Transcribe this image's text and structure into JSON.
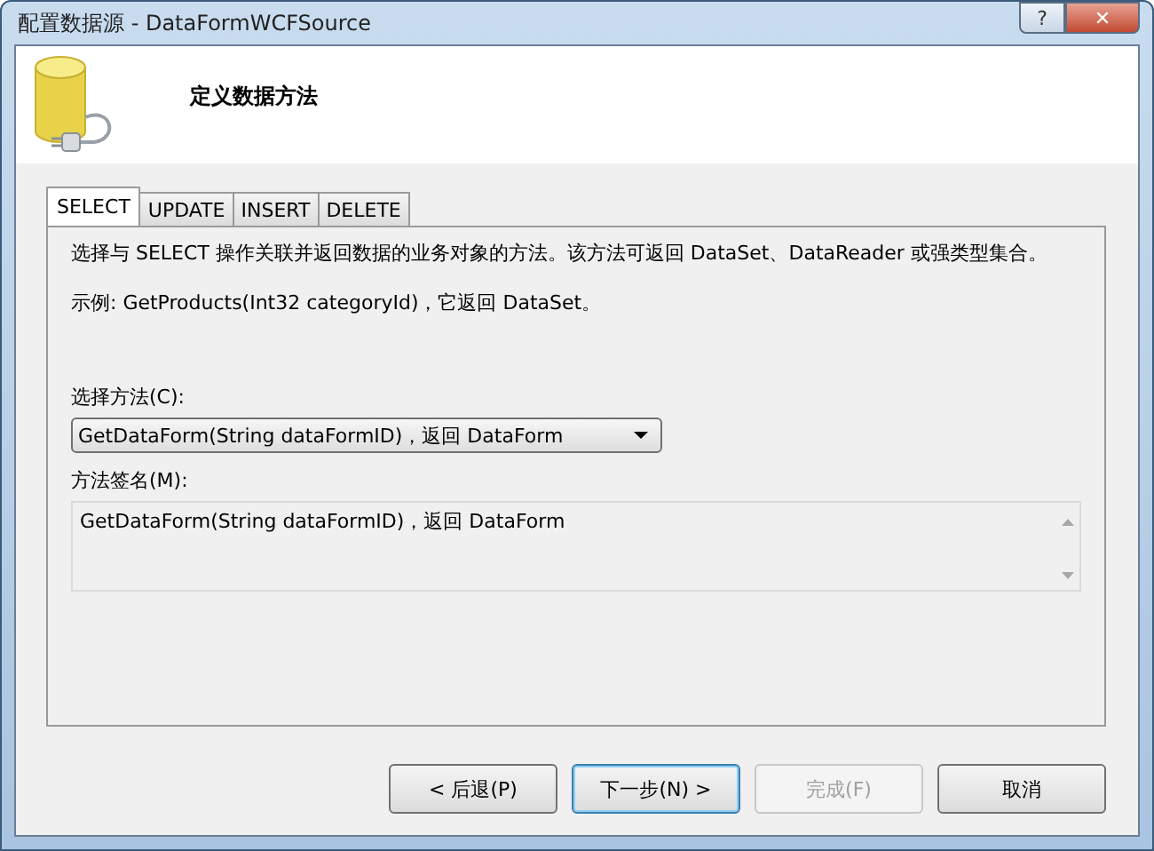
{
  "window": {
    "title": "配置数据源 - DataFormWCFSource",
    "controls": [
      "?",
      "✕"
    ]
  },
  "header": {
    "title": "定义数据方法"
  },
  "tabs": [
    {
      "label": "SELECT",
      "selected": true
    },
    {
      "label": "UPDATE",
      "selected": false
    },
    {
      "label": "INSERT",
      "selected": false
    },
    {
      "label": "DELETE",
      "selected": false
    }
  ],
  "description": "选择与 SELECT 操作关联并返回数据的业务对象的方法。该方法可返回 DataSet、DataReader 或强类型集合。",
  "example": "示例: GetProducts(Int32 categoryId)，它返回 DataSet。",
  "method": {
    "label": "选择方法(C):",
    "value": "GetDataForm(String dataFormID)，返回 DataForm"
  },
  "signature": {
    "label": "方法签名(M):",
    "value": "GetDataForm(String dataFormID)，返回 DataForm"
  },
  "buttons": [
    {
      "label": "< 后退(P)",
      "disabled": false,
      "default": false
    },
    {
      "label": "下一步(N) >",
      "disabled": false,
      "default": true
    },
    {
      "label": "完成(F)",
      "disabled": true,
      "default": false
    },
    {
      "label": "取消",
      "disabled": false,
      "default": false
    }
  ]
}
